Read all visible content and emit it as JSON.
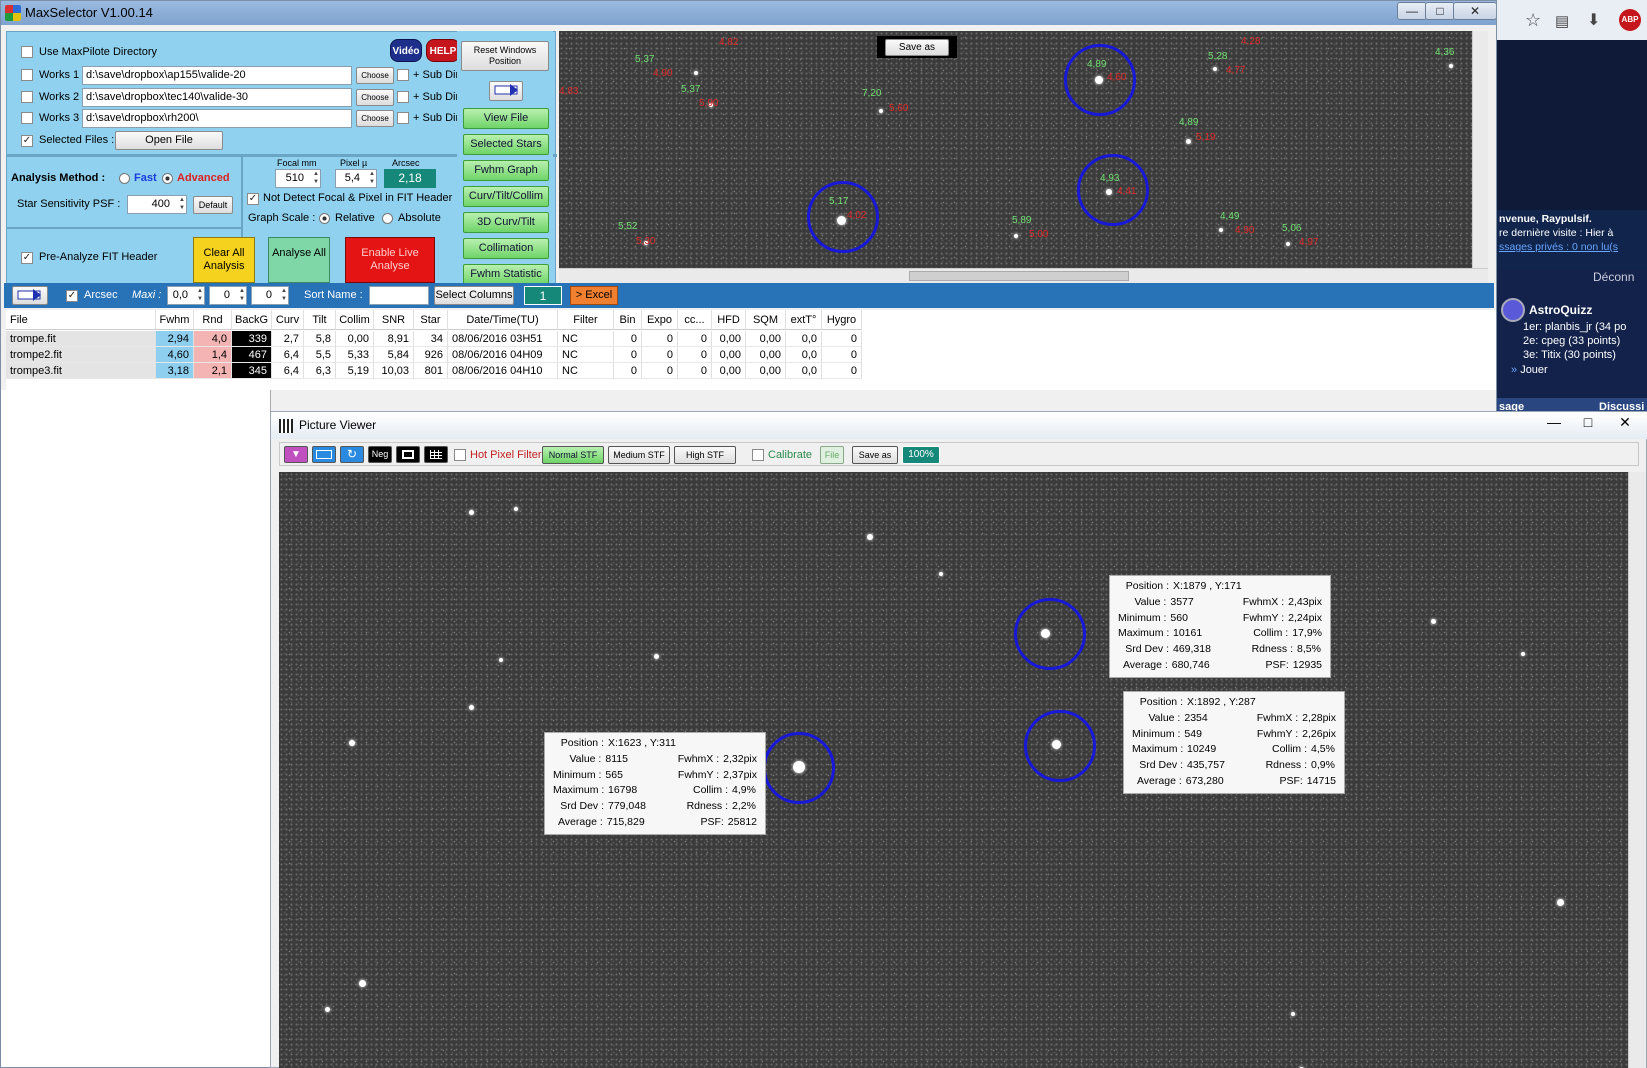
{
  "window": {
    "title": "MaxSelector V1.00.14",
    "min": "—",
    "max": "□",
    "close": "✕"
  },
  "ctrl": {
    "use_maxpilote": "Use MaxPilote Directory",
    "works": [
      {
        "label": "Works 1",
        "path": "d:\\save\\dropbox\\ap155\\valide-20",
        "choose": "Choose",
        "subdir": "+ Sub Dir."
      },
      {
        "label": "Works 2",
        "path": "d:\\save\\dropbox\\tec140\\valide-30",
        "choose": "Choose",
        "subdir": "+ Sub Dir."
      },
      {
        "label": "Works 3",
        "path": "d:\\save\\dropbox\\rh200\\",
        "choose": "Choose",
        "subdir": "+ Sub Dir."
      }
    ],
    "selected_files": "Selected Files :",
    "open_file": "Open File",
    "video": "Vidéo",
    "help": "HELP",
    "reset_windows": "Reset Windows Position",
    "analysis_method": "Analysis Method :",
    "fast": "Fast",
    "advanced": "Advanced",
    "star_sensitivity": "Star Sensitivity  PSF :",
    "psf_value": "400",
    "default": "Default",
    "focal_label": "Focal mm",
    "focal_value": "510",
    "pixel_label": "Pixel µ",
    "pixel_value": "5,4",
    "arcsec_label": "Arcsec",
    "arcsec_value": "2,18",
    "not_detect": "Not Detect Focal & Pixel in FIT Header",
    "graph_scale": "Graph Scale :",
    "relative": "Relative",
    "absolute": "Absolute",
    "pre_analyze": "Pre-Analyze FIT Header",
    "clear_all": "Clear All Analysis",
    "analyse_all": "Analyse All",
    "enable_live": "Enable Live Analyse"
  },
  "side_buttons": [
    "View File",
    "Selected Stars",
    "Fwhm Graph",
    "Curv/Tilt/Collim",
    "3D Curv/Tilt",
    "Collimation",
    "Fwhm Statistic"
  ],
  "preview": {
    "save_as": "Save as",
    "labels": [
      {
        "g": "5,37",
        "r": "4,90"
      },
      {
        "g": "",
        "r": "4,82"
      },
      {
        "g": "5,37",
        "r": "5,90"
      },
      {
        "g": "7,20",
        "r": "5,60"
      },
      {
        "g": "4,89",
        "r": "4,60"
      },
      {
        "g": "5,28",
        "r": "4,77"
      },
      {
        "g": "",
        "r": "4,28"
      },
      {
        "g": "4,36",
        "r": ""
      },
      {
        "g": "4,89",
        "r": "5,19"
      },
      {
        "g": "4,93",
        "r": "4,41"
      },
      {
        "g": "5,17",
        "r": "4,02"
      },
      {
        "g": "5,52",
        "r": "5,30"
      },
      {
        "g": "5,89",
        "r": "5,00"
      },
      {
        "g": "4,49",
        "r": "4,90"
      },
      {
        "g": "5,06",
        "r": "4,97"
      },
      {
        "g": "",
        "r": "4,83"
      }
    ]
  },
  "toolbar2": {
    "arcsec": "Arcsec",
    "maxi": "Maxi :",
    "maxi_value": "0,0",
    "v2": "0",
    "v3": "0",
    "sort_name": "Sort Name :",
    "select_columns": "Select Columns",
    "count": "1",
    "excel": "> Excel"
  },
  "table": {
    "columns": [
      "File",
      "Fwhm",
      "Rnd",
      "BackG",
      "Curv",
      "Tilt",
      "Collim",
      "SNR",
      "Star",
      "Date/Time(TU)",
      "Filter",
      "Bin",
      "Expo",
      "cc...",
      "HFD",
      "SQM",
      "extT°",
      "Hygro"
    ],
    "rows": [
      [
        "trompe.fit",
        "2,94",
        "4,0",
        "339",
        "2,7",
        "5,8",
        "0,00",
        "8,91",
        "34",
        "08/06/2016 03H51",
        "NC",
        "0",
        "0",
        "0",
        "0,00",
        "0,00",
        "0,0",
        "0"
      ],
      [
        "trompe2.fit",
        "4,60",
        "1,4",
        "467",
        "6,4",
        "5,5",
        "5,33",
        "5,84",
        "926",
        "08/06/2016 04H09",
        "NC",
        "0",
        "0",
        "0",
        "0,00",
        "0,00",
        "0,0",
        "0"
      ],
      [
        "trompe3.fit",
        "3,18",
        "2,1",
        "345",
        "6,4",
        "6,3",
        "5,19",
        "10,03",
        "801",
        "08/06/2016 04H10",
        "NC",
        "0",
        "0",
        "0",
        "0,00",
        "0,00",
        "0,0",
        "0"
      ]
    ]
  },
  "browser": {
    "welcome1": "nvenue, Raypulsif.",
    "welcome2": "re dernière visite : Hier à",
    "welcome3": "ssages privés : 0 non lu(s",
    "logout": "Déconn",
    "quiz": "AstroQuizz",
    "q1": "1er: planbis_jr (34 po",
    "q2": "2e: cpeg (33 points)",
    "q3": "3e: Titix (30 points)",
    "play": "Jouer",
    "bar1": "sage",
    "bar2": "Discussi"
  },
  "viewer": {
    "title": "Picture Viewer",
    "hot_pixel": "Hot Pixel Filter",
    "normal": "Normal STF",
    "medium": "Medium STF",
    "high": "High STF",
    "calibrate": "Calibrate",
    "file": "File",
    "save_as": "Save as",
    "zoom": "100%",
    "neg": "Neg",
    "info": [
      {
        "pos": "X:1879 , Y:171",
        "value": "3577",
        "min": "560",
        "max": "10161",
        "sd": "469,318",
        "avg": "680,746",
        "fx": "2,43pix",
        "fy": "2,24pix",
        "collim": "17,9%",
        "rd": "8,5%",
        "psf": "12935"
      },
      {
        "pos": "X:1892 , Y:287",
        "value": "2354",
        "min": "549",
        "max": "10249",
        "sd": "435,757",
        "avg": "673,280",
        "fx": "2,28pix",
        "fy": "2,26pix",
        "collim": "4,5%",
        "rd": "0,9%",
        "psf": "14715"
      },
      {
        "pos": "X:1623 , Y:311",
        "value": "8115",
        "min": "565",
        "max": "16798",
        "sd": "779,048",
        "avg": "715,829",
        "fx": "2,32pix",
        "fy": "2,37pix",
        "collim": "4,9%",
        "rd": "2,2%",
        "psf": "25812"
      }
    ],
    "keys": {
      "pos": "Position :",
      "value": "Value :",
      "min": "Minimum :",
      "max": "Maximum :",
      "sd": "Srd Dev :",
      "avg": "Average :",
      "fx": "FwhmX :",
      "fy": "FwhmY :",
      "collim": "Collim :",
      "rd": "Rdness :",
      "psf": "PSF:"
    }
  },
  "colors": {
    "fwhm_cell": "#8ecff0",
    "rnd_cell": "#f4b4b4",
    "backg_cell": "#000000",
    "accent": "#2872b8"
  }
}
